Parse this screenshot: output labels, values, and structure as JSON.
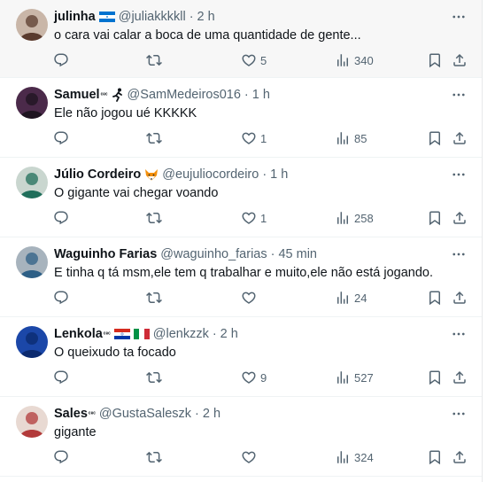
{
  "replies": [
    {
      "name": "julinha",
      "badge": "",
      "handle": "@juliakkkkll",
      "time": "2 h",
      "text": "o cara vai calar a boca de uma quantidade de gente...",
      "emoji": [
        "flag-honduras-icon"
      ],
      "replies": "",
      "reposts": "",
      "likes": "5",
      "views": "340",
      "avatar_colors": [
        "#c9b6a8",
        "#5a3b2e"
      ]
    },
    {
      "name": "Samuel",
      "badge": "ᶜᵉᶜ",
      "handle": "@SamMedeiros016",
      "time": "1 h",
      "text": "Ele não jogou ué KKKKK",
      "emoji": [
        "runner-icon"
      ],
      "replies": "",
      "reposts": "",
      "likes": "1",
      "views": "85",
      "avatar_colors": [
        "#4b2a4a",
        "#1e1420"
      ]
    },
    {
      "name": "Júlio Cordeiro",
      "badge": "",
      "handle": "@eujuliocordeiro",
      "time": "1 h",
      "text": "O gigante vai chegar voando",
      "emoji": [
        "fox-face-icon"
      ],
      "replies": "",
      "reposts": "",
      "likes": "1",
      "views": "258",
      "avatar_colors": [
        "#c9d6cf",
        "#1f6e5a"
      ]
    },
    {
      "name": "Waguinho Farias",
      "badge": "",
      "handle": "@waguinho_farias",
      "time": "45 min",
      "text": "E tinha q tá msm,ele tem q trabalhar e muito,ele não está jogando.",
      "emoji": [],
      "replies": "",
      "reposts": "",
      "likes": "",
      "views": "24",
      "avatar_colors": [
        "#a7b3bd",
        "#2d5f86"
      ]
    },
    {
      "name": "Lenkola",
      "badge": "ᶜᵉᶜ",
      "handle": "@lenkzzk",
      "time": "2 h",
      "text": "O queixudo ta focado",
      "emoji": [
        "flag-paraguay-icon",
        "flag-italy-icon"
      ],
      "replies": "",
      "reposts": "",
      "likes": "9",
      "views": "527",
      "avatar_colors": [
        "#1b47a8",
        "#0b2a6e"
      ]
    },
    {
      "name": "Sales",
      "badge": "ᶜᵉᶜ",
      "handle": "@GustaSaleszk",
      "time": "2 h",
      "text": "gigante",
      "emoji": [],
      "replies": "",
      "reposts": "",
      "likes": "",
      "views": "324",
      "avatar_colors": [
        "#e8d9d2",
        "#b23a3a"
      ]
    }
  ]
}
